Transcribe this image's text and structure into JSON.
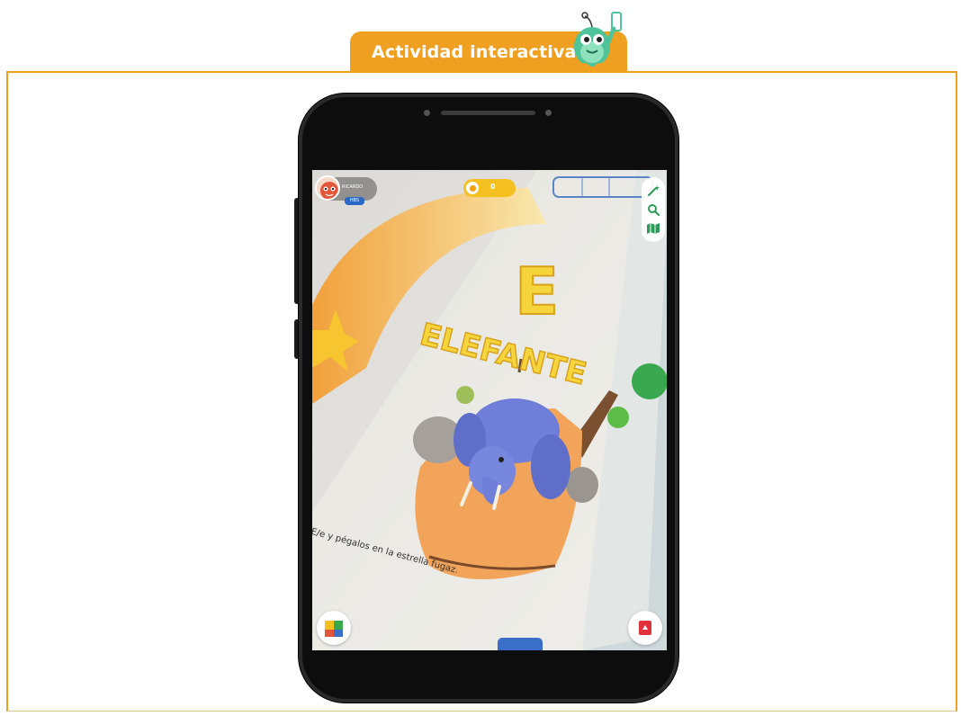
{
  "header": {
    "tab_label": "Actividad interactiva",
    "accent_color": "#f0a020"
  },
  "app": {
    "user": {
      "name": "RICARDO",
      "badge": "HBS"
    },
    "coins": {
      "count": "0"
    },
    "tools": [
      "magic-wand-icon",
      "search-icon",
      "map-icon"
    ],
    "scene": {
      "big_letter": "E",
      "word": "ELEFANTE",
      "instruction": "E/e y pégalos en la estrella fugaz."
    },
    "bottom_left_button_icon": "blocks-icon",
    "bottom_right_button_icon": "card-icon"
  }
}
